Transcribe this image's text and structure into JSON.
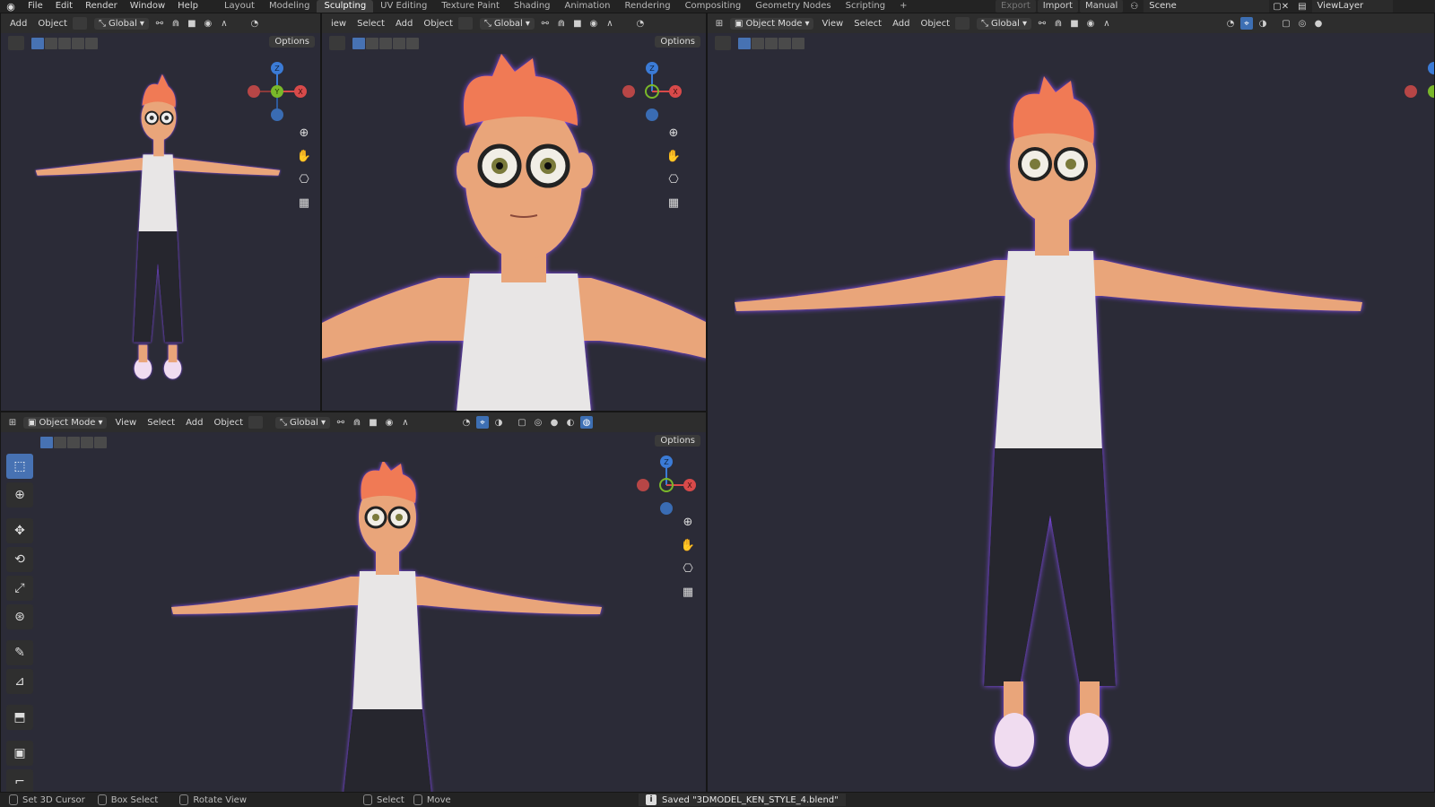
{
  "topbar": {
    "menus": [
      "File",
      "Edit",
      "Render",
      "Window",
      "Help"
    ],
    "workspaces": [
      "Layout",
      "Modeling",
      "Sculpting",
      "UV Editing",
      "Texture Paint",
      "Shading",
      "Animation",
      "Rendering",
      "Compositing",
      "Geometry Nodes",
      "Scripting"
    ],
    "active_workspace": "Sculpting",
    "add_ws": "+",
    "export": "Export",
    "import": "Import",
    "manual": "Manual",
    "scene": "Scene",
    "viewlayer": "ViewLayer"
  },
  "viewport": {
    "mode": "Object Mode",
    "view": "View",
    "select": "Select",
    "add": "Add",
    "object": "Object",
    "orientation": "Global",
    "options": "Options",
    "view_partial": "iew"
  },
  "gizmo": {
    "z": "Z",
    "y": "Y",
    "x": "X"
  },
  "status": {
    "set_cursor": "Set 3D Cursor",
    "box_select": "Box Select",
    "rotate_view": "Rotate View",
    "select": "Select",
    "move": "Move",
    "saved": "Saved \"3DMODEL_KEN_STYLE_4.blend\""
  },
  "colors": {
    "viewport_bg": "#2b2b37",
    "skin": "#e9a57a",
    "hair": "#f07a55",
    "shirt": "#e8e6e6",
    "pants": "#25252e",
    "shoes": "#f0dcf0",
    "rim": "#8a4dff",
    "axis_x": "#d84a4a",
    "axis_y": "#7ab82a",
    "axis_z": "#3b7bd6",
    "accent": "#4772b3"
  }
}
